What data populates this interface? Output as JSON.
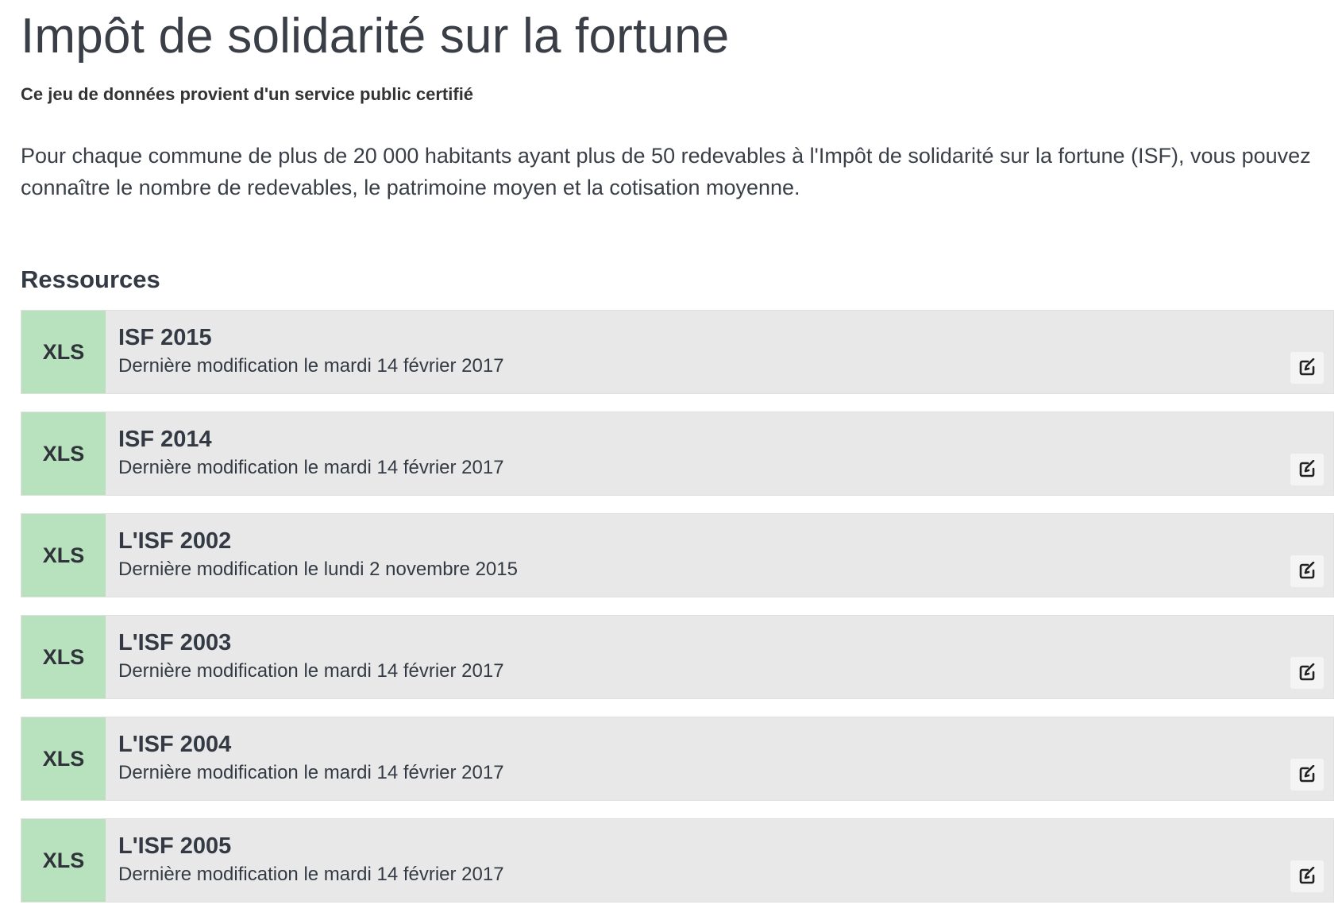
{
  "page": {
    "title": "Impôt de solidarité sur la fortune",
    "certified": "Ce jeu de données provient d'un service public certifié",
    "description": "Pour chaque commune de plus de 20 000 habitants ayant plus de 50 redevables à l'Impôt de solidarité sur la fortune (ISF), vous pouvez connaître le nombre de redevables, le patrimoine moyen et la cotisation moyenne."
  },
  "resources": {
    "heading": "Ressources",
    "items": [
      {
        "format": "XLS",
        "title": "ISF 2015",
        "date": "Dernière modification le mardi 14 février 2017",
        "icon": "edit-icon"
      },
      {
        "format": "XLS",
        "title": "ISF 2014",
        "date": "Dernière modification le mardi 14 février 2017",
        "icon": "edit-icon"
      },
      {
        "format": "XLS",
        "title": "L'ISF 2002",
        "date": "Dernière modification le lundi 2 novembre 2015",
        "icon": "edit-icon"
      },
      {
        "format": "XLS",
        "title": "L'ISF 2003",
        "date": "Dernière modification le mardi 14 février 2017",
        "icon": "edit-icon"
      },
      {
        "format": "XLS",
        "title": "L'ISF 2004",
        "date": "Dernière modification le mardi 14 février 2017",
        "icon": "edit-icon"
      },
      {
        "format": "XLS",
        "title": "L'ISF 2005",
        "date": "Dernière modification le mardi 14 février 2017",
        "icon": "edit-icon"
      }
    ]
  },
  "colors": {
    "format_badge": "#b8e2be",
    "resource_bg": "#e8e8e8",
    "text": "#333a44"
  }
}
